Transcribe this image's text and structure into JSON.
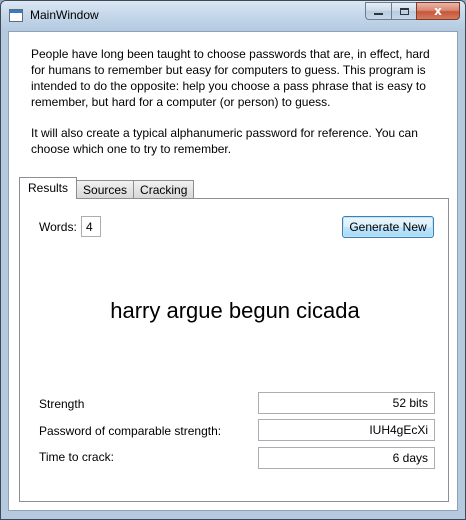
{
  "window": {
    "title": "MainWindow",
    "close_glyph": "x"
  },
  "intro": {
    "paragraph1": "People have long been taught to choose passwords that are, in effect, hard for humans to remember but easy for computers to guess. This program is intended to do the opposite: help you choose a pass phrase that is easy to remember, but hard for a computer (or person) to guess.",
    "paragraph2": "It will also create a typical alphanumeric password for reference. You can choose which one to try to remember."
  },
  "tabs": [
    {
      "label": "Results",
      "active": true
    },
    {
      "label": "Sources",
      "active": false
    },
    {
      "label": "Cracking",
      "active": false
    }
  ],
  "results": {
    "words_label": "Words:",
    "words_value": "4",
    "generate_label": "Generate New",
    "passphrase": "harry argue begun cicada",
    "strength_label": "Strength",
    "strength_value": "52 bits",
    "comparable_label": "Password of comparable strength:",
    "comparable_value": "IUH4gEcXi",
    "crack_label": "Time to crack:",
    "crack_value": "6 days"
  },
  "icons": {
    "app": "app-window-icon",
    "minimize": "minimize-icon",
    "maximize": "maximize-icon",
    "close": "close-icon"
  },
  "colors": {
    "title_gradient_top": "#dbe7f3",
    "close_button": "#c6573a",
    "default_button_border": "#3c7fb1"
  }
}
